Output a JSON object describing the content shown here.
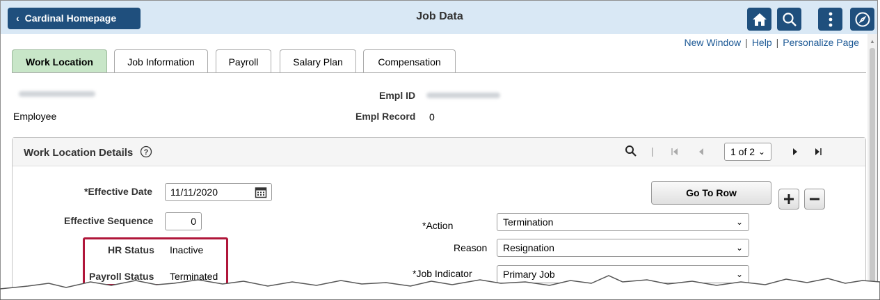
{
  "header": {
    "back_label": "Cardinal Homepage",
    "title": "Job Data"
  },
  "links": {
    "new_window": "New Window",
    "help": "Help",
    "personalize": "Personalize Page"
  },
  "tabs": [
    {
      "label": "Work Location"
    },
    {
      "label": "Job Information"
    },
    {
      "label": "Payroll"
    },
    {
      "label": "Salary Plan"
    },
    {
      "label": "Compensation"
    }
  ],
  "employee": {
    "type": "Employee",
    "empl_id_label": "Empl ID",
    "empl_record_label": "Empl Record",
    "empl_record_value": "0"
  },
  "panel": {
    "title": "Work Location Details",
    "pager": "1 of 2",
    "go_to_row": "Go To Row"
  },
  "fields": {
    "effective_date_label": "*Effective Date",
    "effective_date_value": "11/11/2020",
    "effective_sequence_label": "Effective Sequence",
    "effective_sequence_value": "0",
    "hr_status_label": "HR Status",
    "hr_status_value": "Inactive",
    "payroll_status_label": "Payroll Status",
    "payroll_status_value": "Terminated",
    "action_label": "*Action",
    "action_value": "Termination",
    "reason_label": "Reason",
    "reason_value": "Resignation",
    "job_indicator_label": "*Job Indicator",
    "job_indicator_value": "Primary Job"
  },
  "colors": {
    "header_bg": "#d9e8f5",
    "button_navy": "#1f4f7d",
    "active_tab": "#c8e6c8",
    "highlight_red": "#b0163a",
    "link_blue": "#1a5794"
  }
}
